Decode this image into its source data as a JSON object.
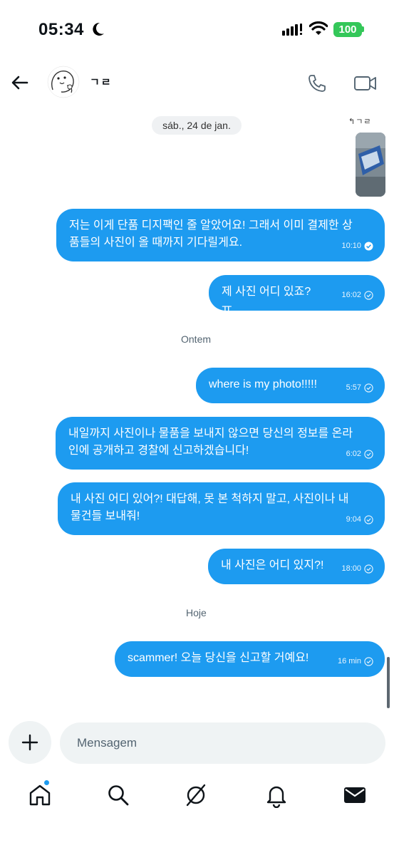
{
  "status_bar": {
    "time": "05:34",
    "battery": "100",
    "icons": [
      "moon-icon",
      "signal-icon",
      "wifi-icon",
      "battery-icon"
    ]
  },
  "header": {
    "contact_name": "ㄱㄹ",
    "icons": [
      "back-arrow-icon",
      "avatar",
      "phone-icon",
      "video-icon"
    ]
  },
  "conversation": {
    "date_chip": "sáb., 24 de jan.",
    "reply_label": "↰ㄱㄹ",
    "messages": [
      {
        "text": "저는 이게 단품 디지팩인 줄 알았어요! 그래서 이미 결제한 상\n품들의 사진이 올 때까지 기다릴게요.",
        "time": "10:10",
        "status": "read"
      },
      {
        "text": "제 사진 어디 있죠? ㅠ",
        "time": "16:02",
        "status": "sent"
      },
      {
        "text": "where is my photo!!!!!",
        "time": "5:57",
        "status": "sent"
      },
      {
        "text": "내일까지 사진이나 물품을 보내지 않으면 당신의 정보를 온라\n인에 공개하고 경찰에 신고하겠습니다!",
        "time": "6:02",
        "status": "sent"
      },
      {
        "text": "내 사진 어디 있어?! 대답해, 못 본 척하지 말고, 사진이나 내\n물건들 보내줘!",
        "time": "9:04",
        "status": "sent"
      },
      {
        "text": "내 사진은 어디 있지?!",
        "time": "18:00",
        "status": "sent"
      },
      {
        "text": "scammer! 오늘 당신을 신고할 거예요!",
        "time": "16 min",
        "status": "sent"
      }
    ],
    "day_labels": [
      "Ontem",
      "Hoje"
    ]
  },
  "composer": {
    "placeholder": "Mensagem",
    "value": ""
  },
  "bottom_nav": {
    "items": [
      "home-icon",
      "search-icon",
      "grok-icon",
      "notifications-icon",
      "messages-icon"
    ]
  },
  "colors": {
    "bubble": "#1d9bf0",
    "chip": "#eff1f3",
    "input": "#eff3f4",
    "battery": "#34c759"
  }
}
